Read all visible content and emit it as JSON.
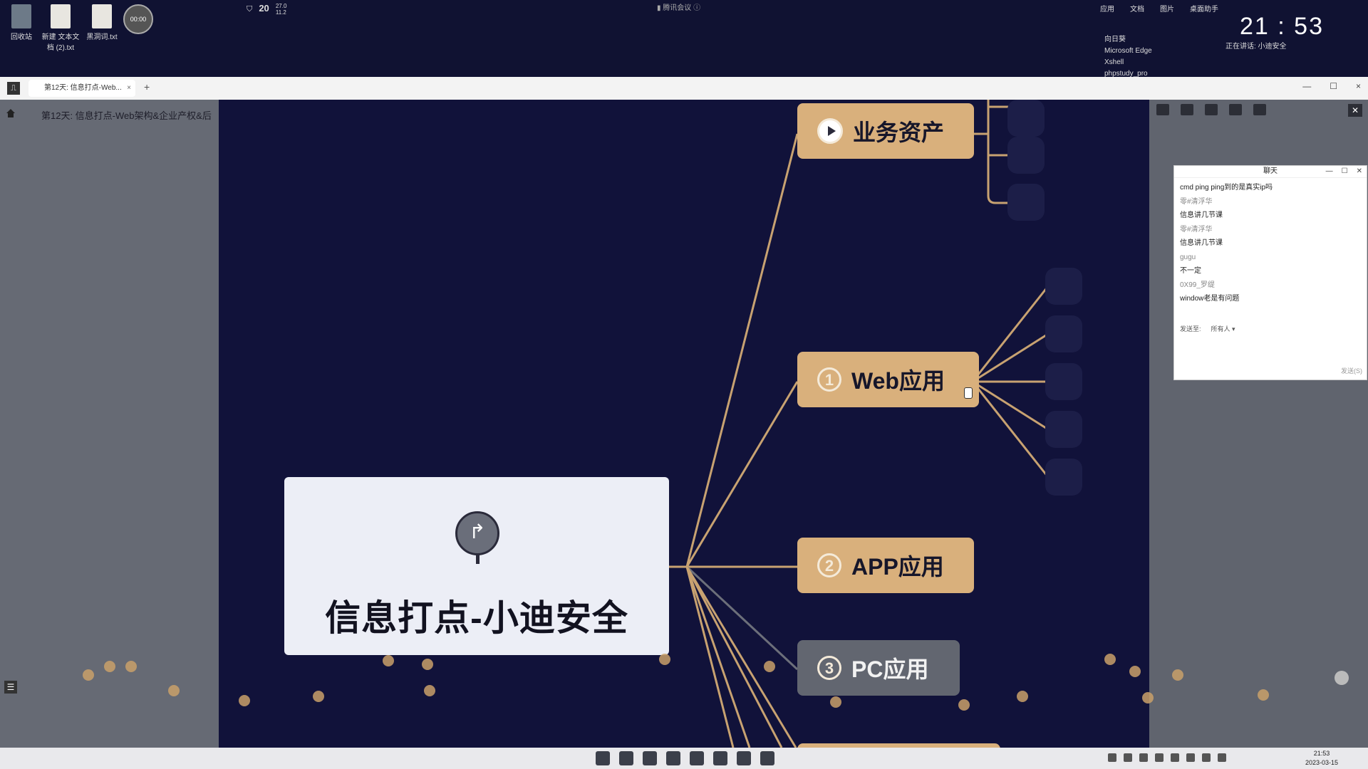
{
  "desktop": {
    "icons": [
      {
        "label": "回收站",
        "kind": "bin"
      },
      {
        "label": "新建 文本文档 (2).txt",
        "kind": "file"
      },
      {
        "label": "黑洞词.txt",
        "kind": "file"
      },
      {
        "label": "00:00",
        "kind": "recorder"
      }
    ],
    "weather": {
      "temp": "20",
      "hi": "27.0",
      "lo": "11.2"
    },
    "meeting": "腾讯会议",
    "tray_header": [
      "应用",
      "文档",
      "图片"
    ],
    "tray_sub": "桌面助手",
    "tray_apps": [
      "向日葵",
      "Microsoft Edge",
      "Xshell",
      "phpstudy_pro"
    ],
    "clock": "21 : 53",
    "speaking": "正在讲话: 小迪安全"
  },
  "browser": {
    "tab_title": "第12天: 信息打点-Web...",
    "tab_close": "×",
    "new_tab": "+",
    "controls": [
      "—",
      "☐",
      "×"
    ]
  },
  "left_panel": {
    "doc_title": "第12天: 信息打点-Web架构&企业产权&后"
  },
  "mindmap": {
    "root": "信息打点-小迪安全",
    "nodes": [
      {
        "label": "业务资产",
        "marker": "play"
      },
      {
        "label": "Web应用",
        "marker": "1"
      },
      {
        "label": "APP应用",
        "marker": "2"
      },
      {
        "label": "PC应用",
        "marker": "3"
      }
    ],
    "accent": "#d9b07c",
    "line_color": "#c8a271"
  },
  "chat": {
    "title": "聊天",
    "messages": [
      {
        "text": "cmd ping ping到的是真实ip吗",
        "type": "msg"
      },
      {
        "text": "零#清浮华",
        "type": "user"
      },
      {
        "text": "信息讲几节课",
        "type": "msg"
      },
      {
        "text": "零#清浮华",
        "type": "user"
      },
      {
        "text": "信息讲几节课",
        "type": "msg"
      },
      {
        "text": "gugu",
        "type": "user"
      },
      {
        "text": "不一定",
        "type": "msg"
      },
      {
        "text": "0X99_罗缇",
        "type": "user"
      },
      {
        "text": "window老是有问题",
        "type": "msg"
      }
    ],
    "send_to_label": "发送至:",
    "send_to_value": "所有人 ▾",
    "send_button": "发送(S)"
  },
  "taskbar": {
    "time": "21:53",
    "date": "2023-03-15"
  }
}
